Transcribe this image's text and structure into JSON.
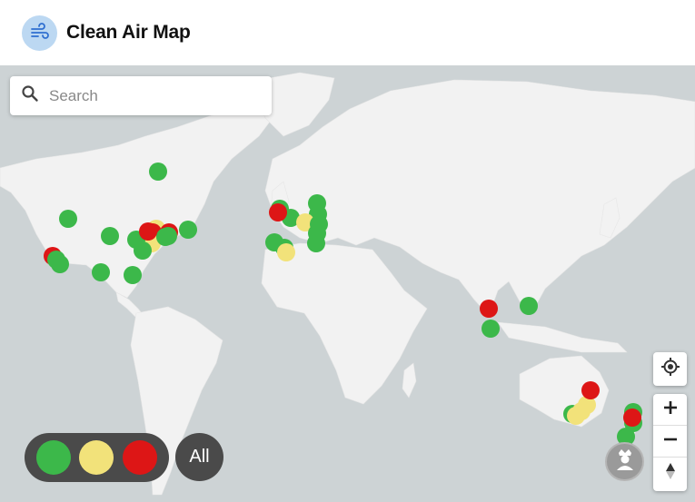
{
  "header": {
    "title": "Clean Air Map",
    "logo_icon": "wind-icon"
  },
  "search": {
    "placeholder": "Search",
    "value": "",
    "icon": "search-icon"
  },
  "map": {
    "background_color": "#cdd3d5",
    "land_color": "#f2f2f2",
    "markers": [
      {
        "status": "good"
      },
      {
        "status": "good"
      },
      {
        "status": "bad"
      },
      {
        "status": "good"
      },
      {
        "status": "good"
      },
      {
        "status": "good"
      },
      {
        "status": "good"
      },
      {
        "status": "moderate"
      },
      {
        "status": "bad"
      },
      {
        "status": "bad"
      },
      {
        "status": "moderate"
      },
      {
        "status": "good"
      },
      {
        "status": "good"
      },
      {
        "status": "good"
      },
      {
        "status": "good"
      },
      {
        "status": "good"
      },
      {
        "status": "good"
      },
      {
        "status": "good"
      },
      {
        "status": "bad"
      },
      {
        "status": "good"
      },
      {
        "status": "good"
      },
      {
        "status": "good"
      },
      {
        "status": "moderate"
      },
      {
        "status": "good"
      },
      {
        "status": "good"
      },
      {
        "status": "bad"
      },
      {
        "status": "moderate"
      },
      {
        "status": "good"
      },
      {
        "status": "good"
      },
      {
        "status": "moderate"
      },
      {
        "status": "good"
      },
      {
        "status": "bad"
      },
      {
        "status": "good"
      },
      {
        "status": "good"
      },
      {
        "status": "bad"
      },
      {
        "status": "moderate"
      },
      {
        "status": "moderate"
      },
      {
        "status": "good"
      },
      {
        "status": "good"
      },
      {
        "status": "bad"
      },
      {
        "status": "good"
      },
      {
        "status": "good"
      }
    ]
  },
  "legend": {
    "colors": {
      "good": "#3cb84a",
      "moderate": "#f2e27a",
      "bad": "#dd1616"
    },
    "filters": [
      {
        "status": "good",
        "label": "good"
      },
      {
        "status": "moderate",
        "label": "moderate"
      },
      {
        "status": "bad",
        "label": "bad"
      }
    ],
    "all_label": "All"
  },
  "controls": {
    "locate_icon": "crosshair-icon",
    "zoom_in_icon": "plus-icon",
    "zoom_out_icon": "minus-icon",
    "compass_icon": "compass-icon",
    "avatar_icon": "user-avatar-icon"
  }
}
